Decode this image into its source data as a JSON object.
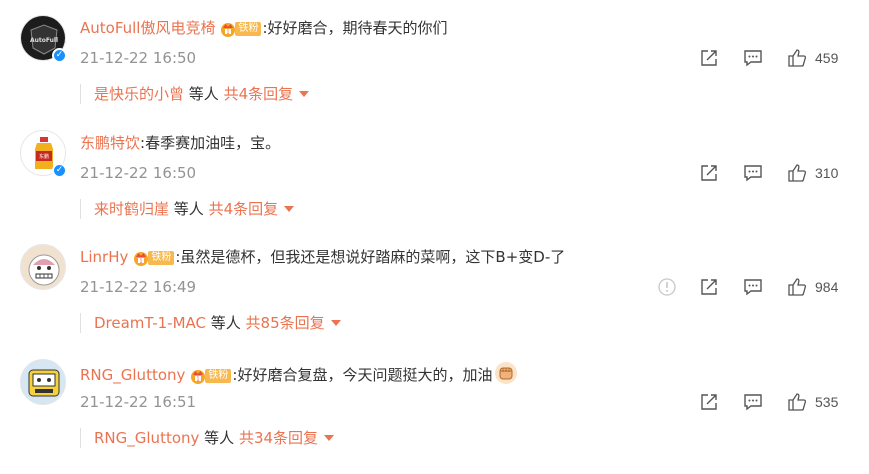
{
  "badge_label": "铁粉",
  "comments": [
    {
      "username": "AutoFull傲风电竞椅",
      "has_fan_badge": true,
      "verified": true,
      "text": "好好磨合，期待春天的你们",
      "time": "21-12-22 16:50",
      "likes": "459",
      "replies": {
        "first_replier": "是快乐的小曾",
        "middle": " 等人 ",
        "total": "共4条回复"
      }
    },
    {
      "username": "东鹏特饮",
      "has_fan_badge": false,
      "verified": true,
      "text": "春季赛加油哇，宝。",
      "time": "21-12-22 16:50",
      "likes": "310",
      "replies": {
        "first_replier": "来时鹤归崖",
        "middle": " 等人 ",
        "total": "共4条回复"
      }
    },
    {
      "username": "LinrHy",
      "has_fan_badge": true,
      "verified": false,
      "text": "虽然是德杯，但我还是想说好踏麻的菜啊，这下B+变D-了",
      "time": "21-12-22 16:49",
      "likes": "984",
      "replies": {
        "first_replier": "DreamT-1-MAC",
        "middle": " 等人 ",
        "total": "共85条回复"
      }
    },
    {
      "username": "RNG_Gluttony",
      "has_fan_badge": true,
      "verified": false,
      "text": "好好磨合复盘，今天问题挺大的，加油",
      "time": "21-12-22 16:51",
      "likes": "535",
      "replies": {
        "first_replier": "RNG_Gluttony",
        "middle": " 等人 ",
        "total": "共34条回复"
      }
    }
  ],
  "colors": {
    "username": "#eb7350",
    "time": "#939393",
    "badge": "#f8b84d",
    "verified": "#1890ff"
  },
  "icons": [
    "share-icon",
    "comment-icon",
    "like-icon",
    "report-icon",
    "fist-emoji",
    "crown-icon",
    "verified-icon"
  ]
}
